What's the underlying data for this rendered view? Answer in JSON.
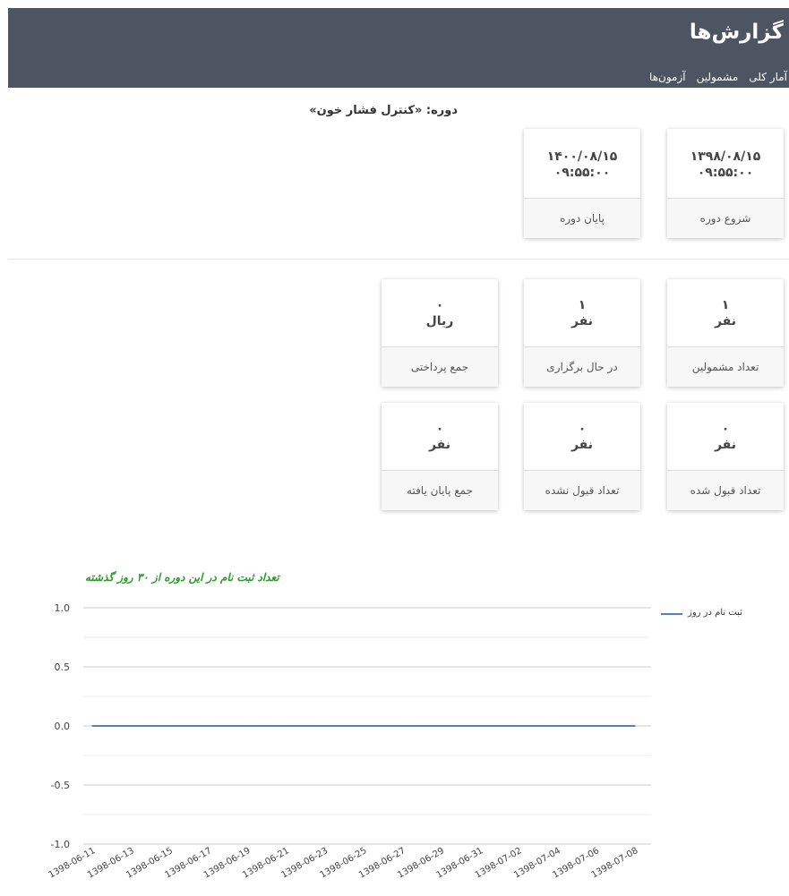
{
  "header": {
    "title": "گزارش‌ها",
    "nav": [
      "آمار کلی",
      "مشمولین",
      "آزمون‌ها"
    ]
  },
  "course": {
    "label": "دوره: «کنترل فشار خون»"
  },
  "dates": {
    "start": {
      "date": "۱۳۹۸/۰۸/۱۵",
      "time": "۰۹:۵۵:۰۰",
      "label": "شروع دوره"
    },
    "end": {
      "date": "۱۴۰۰/۰۸/۱۵",
      "time": "۰۹:۵۵:۰۰",
      "label": "پایان دوره"
    }
  },
  "stats": {
    "enrolled": {
      "value": "۱",
      "unit": "نفر",
      "label": "تعداد مشمولین"
    },
    "ongoing": {
      "value": "۱",
      "unit": "نفر",
      "label": "در حال برگزاری"
    },
    "payments": {
      "value": "۰",
      "unit": "ریال",
      "label": "جمع پرداختی"
    },
    "accepted": {
      "value": "۰",
      "unit": "نفر",
      "label": "تعداد قبول شده"
    },
    "rejected": {
      "value": "۰",
      "unit": "نفر",
      "label": "تعداد قبول نشده"
    },
    "finished": {
      "value": "۰",
      "unit": "نفر",
      "label": "جمع پایان یافته"
    }
  },
  "colors": {
    "header_bg": "#4d5562",
    "chart_title": "#2a9a2a",
    "series_line": "#5a7fbf"
  },
  "chart_data": {
    "type": "line",
    "title": "تعداد ثبت نام در این دوره از ۳۰ روز گذشته",
    "legend_position": "right",
    "grid": true,
    "ylim": [
      -1.0,
      1.0
    ],
    "y_ticks": [
      "1.0",
      "0.5",
      "0.0",
      "-0.5",
      "-1.0"
    ],
    "categories": [
      "1398-06-11",
      "1398-06-13",
      "1398-06-15",
      "1398-06-17",
      "1398-06-19",
      "1398-06-21",
      "1398-06-23",
      "1398-06-25",
      "1398-06-27",
      "1398-06-29",
      "1398-06-31",
      "1398-07-02",
      "1398-07-04",
      "1398-07-06",
      "1398-07-08"
    ],
    "series": [
      {
        "name": "ثبت نام در روز",
        "values": [
          0,
          0,
          0,
          0,
          0,
          0,
          0,
          0,
          0,
          0,
          0,
          0,
          0,
          0,
          0
        ]
      }
    ]
  }
}
